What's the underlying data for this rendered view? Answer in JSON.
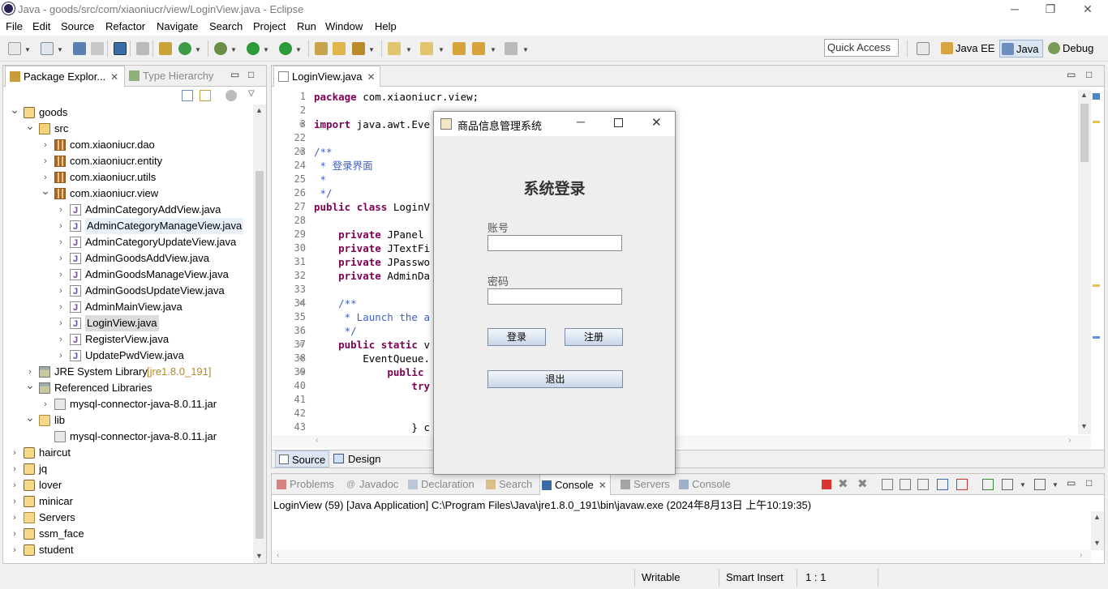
{
  "window": {
    "title": "Java - goods/src/com/xiaoniucr/view/LoginView.java - Eclipse",
    "minimize": "─",
    "restore": "❐",
    "close": "✕"
  },
  "menu": [
    "File",
    "Edit",
    "Source",
    "Refactor",
    "Navigate",
    "Search",
    "Project",
    "Run",
    "Window",
    "Help"
  ],
  "quick_access": {
    "placeholder": "Quick Access"
  },
  "perspectives": [
    {
      "label": "Java EE",
      "icon": "java-ee-perspective-icon"
    },
    {
      "label": "Java",
      "icon": "java-perspective-icon"
    },
    {
      "label": "Debug",
      "icon": "debug-perspective-icon"
    }
  ],
  "explorer": {
    "tabs": [
      {
        "label": "Package Explor...",
        "close": "✕"
      },
      {
        "label": "Type Hierarchy"
      }
    ],
    "tree": [
      {
        "label": "goods",
        "depth": 0,
        "arrow": "expanded",
        "icon": "project"
      },
      {
        "label": "src",
        "depth": 1,
        "arrow": "expanded",
        "icon": "src"
      },
      {
        "label": "com.xiaoniucr.dao",
        "depth": 2,
        "arrow": "collapsed",
        "icon": "pkg"
      },
      {
        "label": "com.xiaoniucr.entity",
        "depth": 2,
        "arrow": "collapsed",
        "icon": "pkg"
      },
      {
        "label": "com.xiaoniucr.utils",
        "depth": 2,
        "arrow": "collapsed",
        "icon": "pkg"
      },
      {
        "label": "com.xiaoniucr.view",
        "depth": 2,
        "arrow": "expanded",
        "icon": "pkg"
      },
      {
        "label": "AdminCategoryAddView.java",
        "depth": 3,
        "arrow": "collapsed",
        "icon": "java"
      },
      {
        "label": "AdminCategoryManageView.java",
        "depth": 3,
        "arrow": "collapsed",
        "icon": "java",
        "highlight": true
      },
      {
        "label": "AdminCategoryUpdateView.java",
        "depth": 3,
        "arrow": "collapsed",
        "icon": "java"
      },
      {
        "label": "AdminGoodsAddView.java",
        "depth": 3,
        "arrow": "collapsed",
        "icon": "java"
      },
      {
        "label": "AdminGoodsManageView.java",
        "depth": 3,
        "arrow": "collapsed",
        "icon": "java"
      },
      {
        "label": "AdminGoodsUpdateView.java",
        "depth": 3,
        "arrow": "collapsed",
        "icon": "java"
      },
      {
        "label": "AdminMainView.java",
        "depth": 3,
        "arrow": "collapsed",
        "icon": "java"
      },
      {
        "label": "LoginView.java",
        "depth": 3,
        "arrow": "collapsed",
        "icon": "java",
        "selected": true
      },
      {
        "label": "RegisterView.java",
        "depth": 3,
        "arrow": "collapsed",
        "icon": "java"
      },
      {
        "label": "UpdatePwdView.java",
        "depth": 3,
        "arrow": "collapsed",
        "icon": "java"
      },
      {
        "label": "JRE System Library",
        "decoration": "[jre1.8.0_191]",
        "depth": 1,
        "arrow": "collapsed",
        "icon": "lib"
      },
      {
        "label": "Referenced Libraries",
        "depth": 1,
        "arrow": "expanded",
        "icon": "lib"
      },
      {
        "label": "mysql-connector-java-8.0.11.jar",
        "depth": 2,
        "arrow": "collapsed",
        "icon": "jar"
      },
      {
        "label": "lib",
        "depth": 1,
        "arrow": "expanded",
        "icon": "folder"
      },
      {
        "label": "mysql-connector-java-8.0.11.jar",
        "depth": 2,
        "arrow": "none",
        "icon": "jar"
      },
      {
        "label": "haircut",
        "depth": 0,
        "arrow": "collapsed",
        "icon": "project"
      },
      {
        "label": "jq",
        "depth": 0,
        "arrow": "collapsed",
        "icon": "project"
      },
      {
        "label": "lover",
        "depth": 0,
        "arrow": "collapsed",
        "icon": "project"
      },
      {
        "label": "minicar",
        "depth": 0,
        "arrow": "collapsed",
        "icon": "project"
      },
      {
        "label": "Servers",
        "depth": 0,
        "arrow": "collapsed",
        "icon": "folder"
      },
      {
        "label": "ssm_face",
        "depth": 0,
        "arrow": "collapsed",
        "icon": "project"
      },
      {
        "label": "student",
        "depth": 0,
        "arrow": "collapsed",
        "icon": "project"
      }
    ]
  },
  "editor": {
    "tab": {
      "label": "LoginView.java",
      "close": "✕"
    },
    "lines": [
      {
        "n": "1",
        "code": [
          {
            "t": "package",
            "c": "kw"
          },
          {
            "t": " com.xiaoniucr.view;"
          }
        ]
      },
      {
        "n": "2",
        "code": []
      },
      {
        "n": "3",
        "fold": "⊕",
        "code": [
          {
            "t": "import",
            "c": "kw"
          },
          {
            "t": " java.awt.Eve"
          }
        ]
      },
      {
        "n": "22",
        "code": []
      },
      {
        "n": "23",
        "fold": "⊖",
        "code": [
          {
            "t": "/**",
            "c": "cm"
          }
        ]
      },
      {
        "n": "24",
        "code": [
          {
            "t": " * 登录界面",
            "c": "cm"
          }
        ]
      },
      {
        "n": "25",
        "code": [
          {
            "t": " *",
            "c": "cm"
          }
        ]
      },
      {
        "n": "26",
        "code": [
          {
            "t": " */",
            "c": "cm"
          }
        ]
      },
      {
        "n": "27",
        "code": [
          {
            "t": "public",
            "c": "kw"
          },
          {
            "t": " "
          },
          {
            "t": "class",
            "c": "kw"
          },
          {
            "t": " LoginV"
          }
        ]
      },
      {
        "n": "28",
        "code": []
      },
      {
        "n": "29",
        "code": [
          {
            "t": "    "
          },
          {
            "t": "private",
            "c": "kw"
          },
          {
            "t": " JPanel"
          }
        ]
      },
      {
        "n": "30",
        "code": [
          {
            "t": "    "
          },
          {
            "t": "private",
            "c": "kw"
          },
          {
            "t": " JTextFi"
          }
        ]
      },
      {
        "n": "31",
        "code": [
          {
            "t": "    "
          },
          {
            "t": "private",
            "c": "kw"
          },
          {
            "t": " JPasswo"
          }
        ]
      },
      {
        "n": "32",
        "code": [
          {
            "t": "    "
          },
          {
            "t": "private",
            "c": "kw"
          },
          {
            "t": " AdminDa"
          }
        ]
      },
      {
        "n": "33",
        "code": []
      },
      {
        "n": "34",
        "fold": "⊖",
        "code": [
          {
            "t": "    /**",
            "c": "cm"
          }
        ]
      },
      {
        "n": "35",
        "code": [
          {
            "t": "     * Launch the a",
            "c": "cm"
          }
        ]
      },
      {
        "n": "36",
        "code": [
          {
            "t": "     */",
            "c": "cm"
          }
        ]
      },
      {
        "n": "37",
        "fold": "⊖",
        "code": [
          {
            "t": "    "
          },
          {
            "t": "public",
            "c": "kw"
          },
          {
            "t": " "
          },
          {
            "t": "static",
            "c": "kw"
          },
          {
            "t": " v"
          }
        ]
      },
      {
        "n": "38",
        "fold": "⊖",
        "code": [
          {
            "t": "        EventQueue."
          }
        ]
      },
      {
        "n": "39",
        "fold": "⊖",
        "code": [
          {
            "t": "            "
          },
          {
            "t": "public",
            "c": "kw"
          }
        ]
      },
      {
        "n": "40",
        "code": [
          {
            "t": "                "
          },
          {
            "t": "try",
            "c": "kw"
          }
        ]
      },
      {
        "n": "41",
        "code": []
      },
      {
        "n": "42",
        "code": []
      },
      {
        "n": "43",
        "code": [
          {
            "t": "                } c"
          }
        ]
      }
    ],
    "bottom_tabs": [
      {
        "label": "Source"
      },
      {
        "label": "Design"
      }
    ]
  },
  "dialog": {
    "title": "商品信息管理系统",
    "heading": "系统登录",
    "account_label": "账号",
    "account_value": "",
    "password_label": "密码",
    "password_value": "",
    "login_button": "登录",
    "register_button": "注册",
    "exit_button": "退出"
  },
  "console": {
    "tabs": [
      {
        "label": "Problems",
        "active": false
      },
      {
        "label": "Javadoc",
        "active": false
      },
      {
        "label": "Declaration",
        "active": false
      },
      {
        "label": "Search",
        "active": false
      },
      {
        "label": "Console",
        "active": true
      },
      {
        "label": "Servers",
        "active": false
      },
      {
        "label": "Console",
        "active": false
      }
    ],
    "output": "LoginView (59) [Java Application] C:\\Program Files\\Java\\jre1.8.0_191\\bin\\javaw.exe (2024年8月13日 上午10:19:35)"
  },
  "statusbar": {
    "mode": "Writable",
    "insert": "Smart Insert",
    "position": "1 : 1"
  }
}
